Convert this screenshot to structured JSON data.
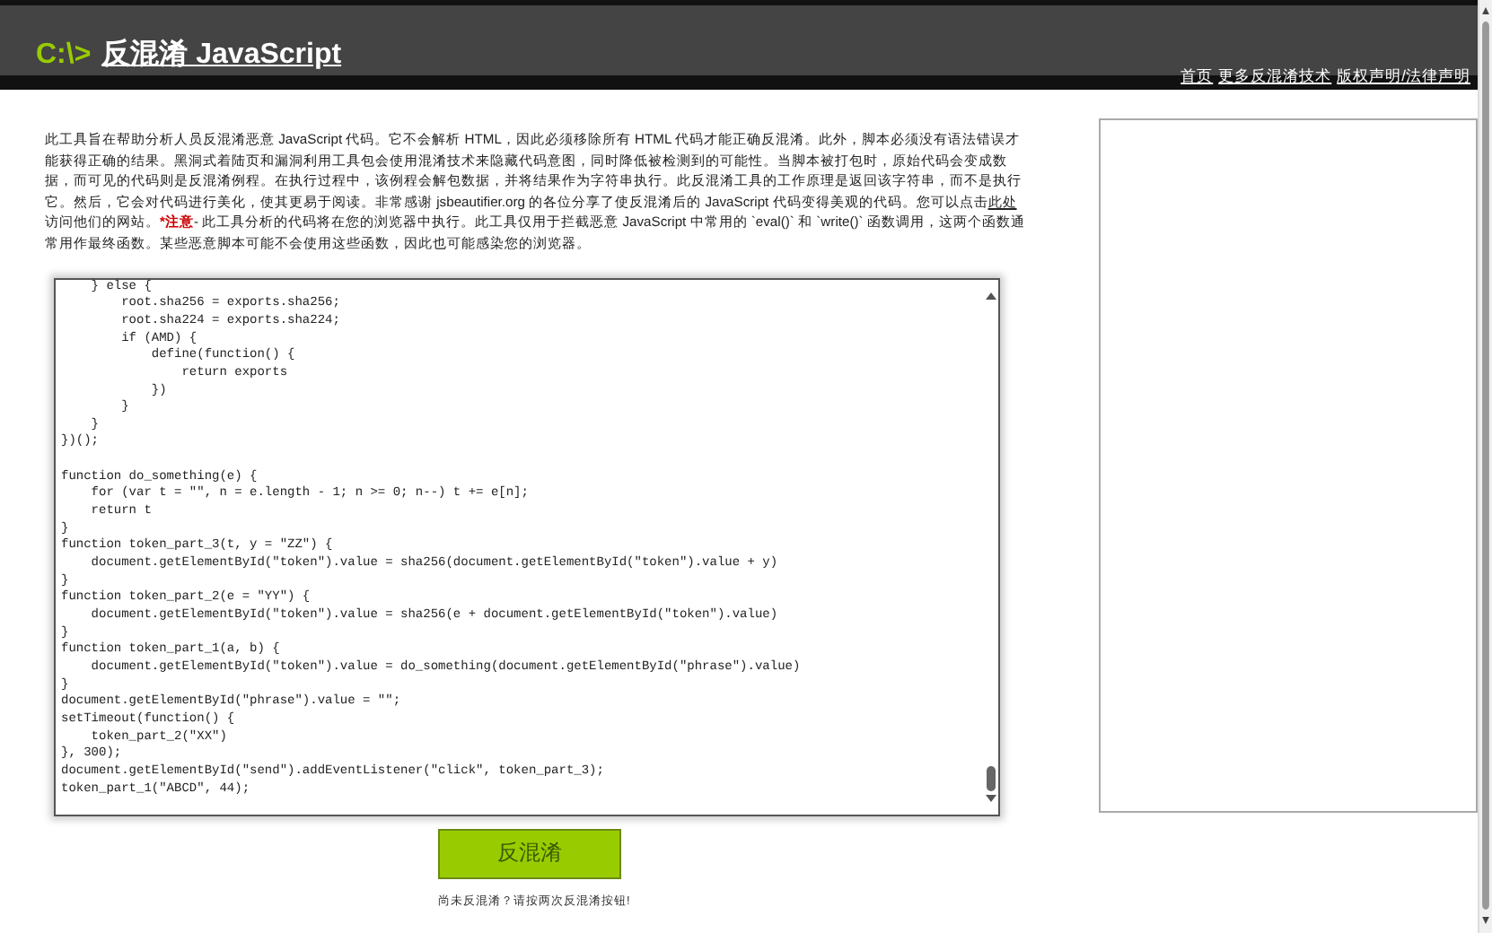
{
  "header": {
    "prompt": "C:\\>",
    "title": "反混淆 JavaScript",
    "nav_links": [
      "首页",
      "更多反混淆技术",
      "版权声明/法律声明"
    ]
  },
  "intro": {
    "before_link": "此工具旨在帮助分析人员反混淆恶意 JavaScript 代码。它不会解析 HTML，因此必须移除所有 HTML 代码才能正确反混淆。此外，脚本必须没有语法错误才能获得正确的结果。黑洞式着陆页和漏洞利用工具包会使用混淆技术来隐藏代码意图，同时降低被检测到的可能性。当脚本被打包时，原始代码会变成数据，而可见的代码则是反混淆例程。在执行过程中，该例程会解包数据，并将结果作为字符串执行。此反混淆工具的工作原理是返回该字符串，而不是执行它。然后，它会对代码进行美化，使其更易于阅读。非常感谢 jsbeautifier.org 的各位分享了使反混淆后的 JavaScript 代码变得美观的代码。您可以点击",
    "link": "此处",
    "after_link": "访问他们的网站。",
    "warning_label": "*注意",
    "after_warning": "- 此工具分析的代码将在您的浏览器中执行。此工具仅用于拦截恶意 JavaScript 中常用的 `eval()` 和 `write()` 函数调用，这两个函数通常用作最终函数。某些恶意脚本可能不会使用这些函数，因此也可能感染您的浏览器。"
  },
  "code": "    } else {\n        root.sha256 = exports.sha256;\n        root.sha224 = exports.sha224;\n        if (AMD) {\n            define(function() {\n                return exports\n            })\n        }\n    }\n})();\n\nfunction do_something(e) {\n    for (var t = \"\", n = e.length - 1; n >= 0; n--) t += e[n];\n    return t\n}\nfunction token_part_3(t, y = \"ZZ\") {\n    document.getElementById(\"token\").value = sha256(document.getElementById(\"token\").value + y)\n}\nfunction token_part_2(e = \"YY\") {\n    document.getElementById(\"token\").value = sha256(e + document.getElementById(\"token\").value)\n}\nfunction token_part_1(a, b) {\n    document.getElementById(\"token\").value = do_something(document.getElementById(\"phrase\").value)\n}\ndocument.getElementById(\"phrase\").value = \"\";\nsetTimeout(function() {\n    token_part_2(\"XX\")\n}, 300);\ndocument.getElementById(\"send\").addEventListener(\"click\", token_part_3);\ntoken_part_1(\"ABCD\", 44);",
  "button": "反混淆",
  "hint": "尚未反混淆？请按两次反混淆按钮!"
}
